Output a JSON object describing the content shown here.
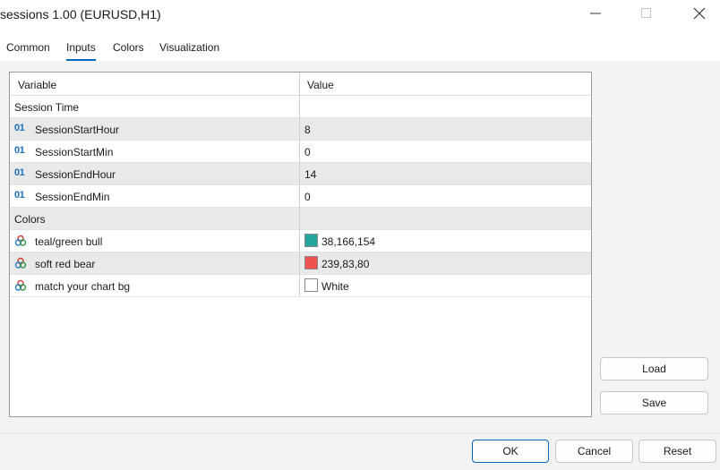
{
  "window": {
    "title": "sessions 1.00 (EURUSD,H1)"
  },
  "tabs": [
    {
      "label": "Common"
    },
    {
      "label": "Inputs"
    },
    {
      "label": "Colors"
    },
    {
      "label": "Visualization"
    }
  ],
  "active_tab": "Inputs",
  "grid": {
    "headers": {
      "variable": "Variable",
      "value": "Value"
    },
    "rows": [
      {
        "type": "group",
        "name": "Session Time",
        "value": ""
      },
      {
        "type": "int",
        "icon": "int-param-icon",
        "icon_text": "01",
        "name": "SessionStartHour",
        "value": "8"
      },
      {
        "type": "int",
        "icon": "int-param-icon",
        "icon_text": "01",
        "name": "SessionStartMin",
        "value": "0"
      },
      {
        "type": "int",
        "icon": "int-param-icon",
        "icon_text": "01",
        "name": "SessionEndHour",
        "value": "14"
      },
      {
        "type": "int",
        "icon": "int-param-icon",
        "icon_text": "01",
        "name": "SessionEndMin",
        "value": "0"
      },
      {
        "type": "group",
        "name": "Colors",
        "value": ""
      },
      {
        "type": "color",
        "icon": "color-param-icon",
        "name": "teal/green bull",
        "value": "38,166,154",
        "swatch": "#26a69a"
      },
      {
        "type": "color",
        "icon": "color-param-icon",
        "name": "soft red bear",
        "value": "239,83,80",
        "swatch": "#ef5350"
      },
      {
        "type": "color",
        "icon": "color-param-icon",
        "name": "match your chart bg",
        "value": "White",
        "swatch": "#ffffff"
      }
    ]
  },
  "side_buttons": {
    "load": "Load",
    "save": "Save"
  },
  "footer_buttons": {
    "ok": "OK",
    "cancel": "Cancel",
    "reset": "Reset"
  },
  "colors": {
    "accent": "#0067c0",
    "row_shade": "#e9e9e9",
    "panel": "#f3f3f3"
  }
}
